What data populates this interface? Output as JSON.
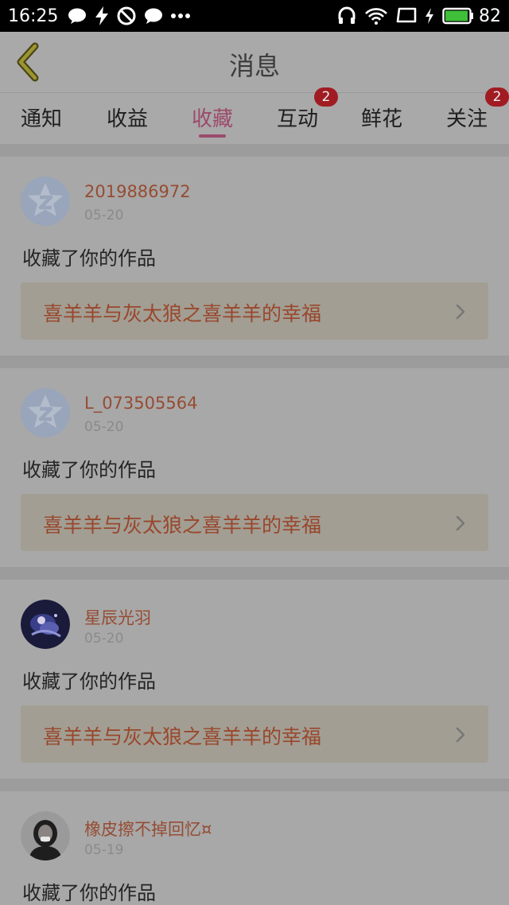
{
  "status_bar": {
    "time": "16:25",
    "battery": "82",
    "left_icons": [
      "chat-bubble-icon",
      "lightning-icon",
      "blocked-icon",
      "message-icon",
      "more-dots-icon"
    ],
    "right_icons": [
      "headphones-icon",
      "wifi-icon",
      "screen-icon",
      "charging-icon",
      "battery-icon"
    ]
  },
  "header": {
    "title": "消息"
  },
  "tabs": [
    {
      "label": "通知",
      "badge": ""
    },
    {
      "label": "收益",
      "badge": ""
    },
    {
      "label": "收藏",
      "badge": "",
      "active": true
    },
    {
      "label": "互动",
      "badge": "2"
    },
    {
      "label": "鲜花",
      "badge": ""
    },
    {
      "label": "关注",
      "badge": "2"
    }
  ],
  "messages": [
    {
      "username": "2019886972",
      "date": "05-20",
      "action": "收藏了你的作品",
      "work": "喜羊羊与灰太狼之喜羊羊的幸福",
      "avatar": "qq-default-avatar"
    },
    {
      "username": "L_073505564",
      "date": "05-20",
      "action": "收藏了你的作品",
      "work": "喜羊羊与灰太狼之喜羊羊的幸福",
      "avatar": "qq-default-avatar"
    },
    {
      "username": "星辰光羽",
      "date": "05-20",
      "action": "收藏了你的作品",
      "work": "喜羊羊与灰太狼之喜羊羊的幸福",
      "avatar": "anime-avatar"
    },
    {
      "username": "橡皮擦不掉回忆¤",
      "date": "05-19",
      "action": "收藏了你的作品",
      "work": "",
      "avatar": "girl-avatar"
    }
  ],
  "colors": {
    "accent": "#9c4a6b",
    "badge": "#a01c22",
    "username": "#964c33",
    "link_bg": "#a29e93"
  }
}
